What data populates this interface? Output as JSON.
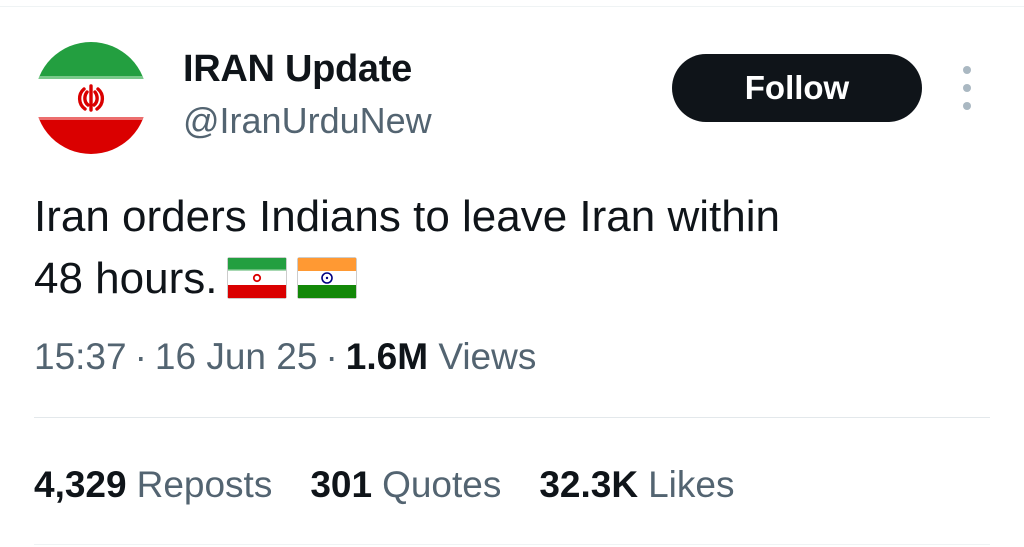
{
  "account": {
    "display_name": "IRAN Update",
    "handle": "@IranUrduNew",
    "avatar_icon": "iran-flag-avatar"
  },
  "actions": {
    "follow_label": "Follow",
    "more_icon": "more-vertical-icon"
  },
  "tweet": {
    "text_line1": "Iran orders Indians to leave Iran within",
    "text_line2": "48 hours.",
    "emoji": [
      "iran-flag-icon",
      "india-flag-icon"
    ]
  },
  "meta": {
    "time": "15:37",
    "separator": "·",
    "date": "16 Jun 25",
    "views_count": "1.6M",
    "views_label": "Views"
  },
  "stats": {
    "reposts_count": "4,329",
    "reposts_label": "Reposts",
    "quotes_count": "301",
    "quotes_label": "Quotes",
    "likes_count": "32.3K",
    "likes_label": "Likes"
  },
  "colors": {
    "text_primary": "#0f1419",
    "text_secondary": "#536471",
    "button_bg": "#0f1419",
    "iran_green": "#239f40",
    "iran_red": "#da0000",
    "india_saffron": "#ff9933",
    "india_green": "#138808",
    "india_chakra": "#000080"
  }
}
